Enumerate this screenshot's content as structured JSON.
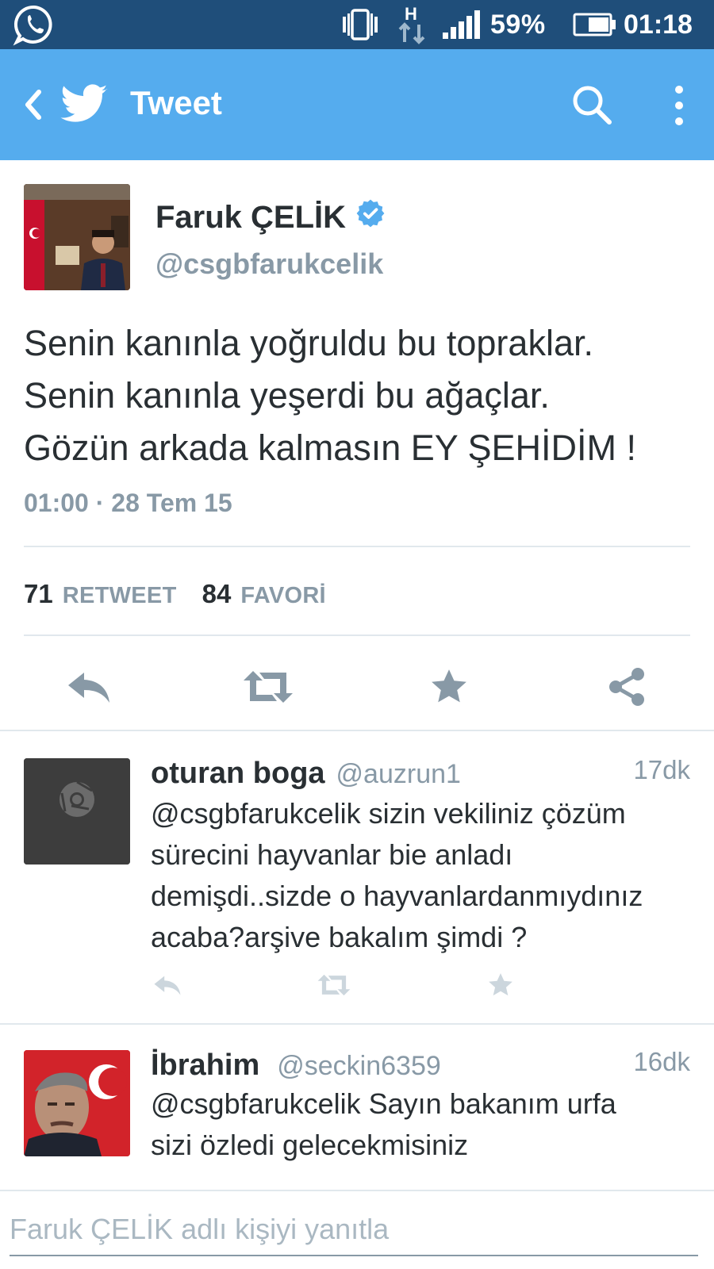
{
  "status_bar": {
    "battery_percent": "59%",
    "time": "01:18",
    "network_label": "H",
    "icons": [
      "whatsapp-icon",
      "vibrate-icon",
      "data-arrows-icon",
      "signal-icon",
      "battery-icon"
    ]
  },
  "toolbar": {
    "title": "Tweet",
    "icons": [
      "back-arrow-icon",
      "twitter-bird-icon",
      "search-icon",
      "more-vert-icon"
    ],
    "color": "#55acee"
  },
  "tweet": {
    "author_name": "Faruk ÇELİK",
    "author_handle": "@csgbfarukcelik",
    "verified": true,
    "text_lines": [
      "Senin kanınla yoğruldu bu topraklar.",
      "Senin kanınla yeşerdi bu ağaçlar.",
      "Gözün arkada kalmasın EY ŞEHİDİM !"
    ],
    "timestamp": "01:00 · 28 Tem 15",
    "retweet_count": "71",
    "retweet_label": "RETWEET",
    "favorite_count": "84",
    "favorite_label": "FAVORİ",
    "actions": [
      "reply-icon",
      "retweet-icon",
      "favorite-star-icon",
      "share-icon"
    ]
  },
  "replies": [
    {
      "name": "oturan boga",
      "handle": "@auzrun1",
      "time": "17dk",
      "text_lines": [
        "@csgbfarukcelik sizin vekiliniz çözüm",
        "sürecini hayvanlar bie anladı",
        "demişdi..sizde o hayvanlardanmıydınız",
        "acaba?arşive bakalım şimdi ?"
      ]
    },
    {
      "name": "İbrahim",
      "handle": "@seckin6359",
      "time": "16dk",
      "text_lines": [
        "@csgbfarukcelik Sayın bakanım urfa",
        "sizi özledi gelecekmisiniz"
      ]
    }
  ],
  "composer": {
    "placeholder": "Faruk ÇELİK adlı kişiyi yanıtla"
  },
  "colors": {
    "twitter_blue": "#55acee",
    "status_bar": "#1f4e7a",
    "text_dark": "#292f33",
    "text_gray": "#8899a6",
    "divider": "#e1e8ed",
    "verified": "#55acee"
  }
}
